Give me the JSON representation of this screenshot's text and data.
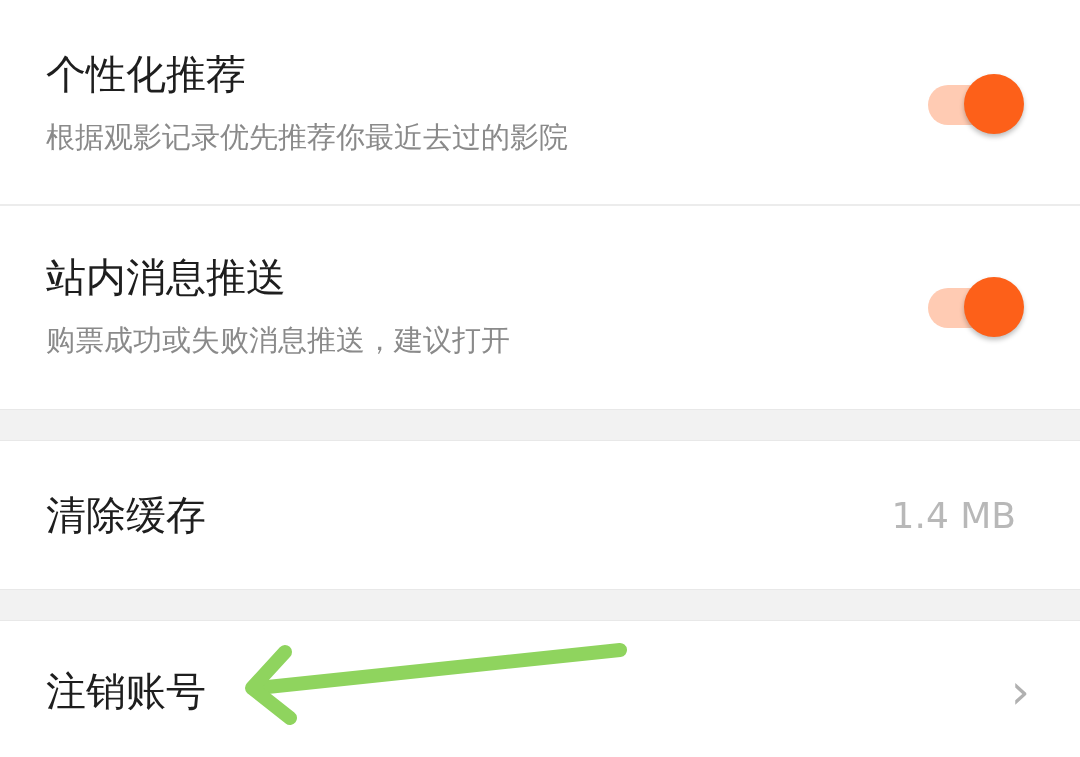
{
  "groups": [
    {
      "items": [
        {
          "kind": "toggle",
          "title": "个性化推荐",
          "subtitle": "根据观影记录优先推荐你最近去过的影院",
          "on": true
        },
        {
          "kind": "toggle",
          "title": "站内消息推送",
          "subtitle": "购票成功或失败消息推送，建议打开",
          "on": true
        }
      ]
    },
    {
      "items": [
        {
          "kind": "value",
          "title": "清除缓存",
          "value": "1.4 MB"
        }
      ]
    },
    {
      "items": [
        {
          "kind": "link",
          "title": "注销账号",
          "chevron": "›"
        }
      ]
    }
  ]
}
